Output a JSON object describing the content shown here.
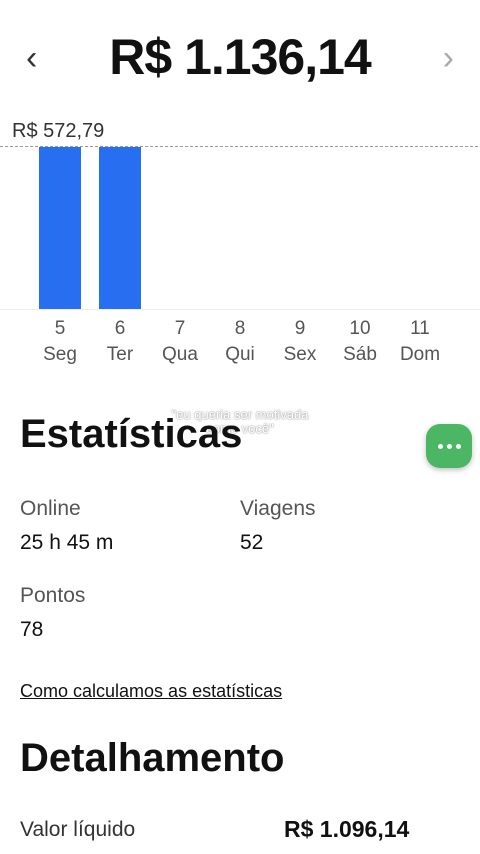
{
  "header": {
    "prev_icon": "chevron-left-icon",
    "next_icon": "chevron-right-icon",
    "prev_glyph": "‹",
    "next_glyph": "›",
    "total": "R$ 1.136,14"
  },
  "chart_data": {
    "type": "bar",
    "max_label": "R$ 572,79",
    "categories": [
      "5 Seg",
      "6 Ter",
      "7 Qua",
      "8 Qui",
      "9 Sex",
      "10 Sáb",
      "11 Dom"
    ],
    "days": [
      {
        "num": "5",
        "name": "Seg",
        "value": 572.79
      },
      {
        "num": "6",
        "name": "Ter",
        "value": 572.79
      },
      {
        "num": "7",
        "name": "Qua",
        "value": 0
      },
      {
        "num": "8",
        "name": "Qui",
        "value": 0
      },
      {
        "num": "9",
        "name": "Sex",
        "value": 0
      },
      {
        "num": "10",
        "name": "Sáb",
        "value": 0
      },
      {
        "num": "11",
        "name": "Dom",
        "value": 0
      }
    ],
    "ylim": [
      0,
      572.79
    ],
    "bar_color": "#276ef1"
  },
  "overlay": {
    "line1": "\"eu queria ser motivada",
    "line2": "como você\""
  },
  "stats": {
    "title": "Estatísticas",
    "online_label": "Online",
    "online_value": "25 h 45 m",
    "trips_label": "Viagens",
    "trips_value": "52",
    "points_label": "Pontos",
    "points_value": "78",
    "how_link": "Como calculamos as estatísticas"
  },
  "fab": {
    "icon": "more-icon",
    "color": "#4bb765"
  },
  "details": {
    "title": "Detalhamento",
    "net_label": "Valor líquido",
    "net_value": "R$ 1.096,14"
  }
}
